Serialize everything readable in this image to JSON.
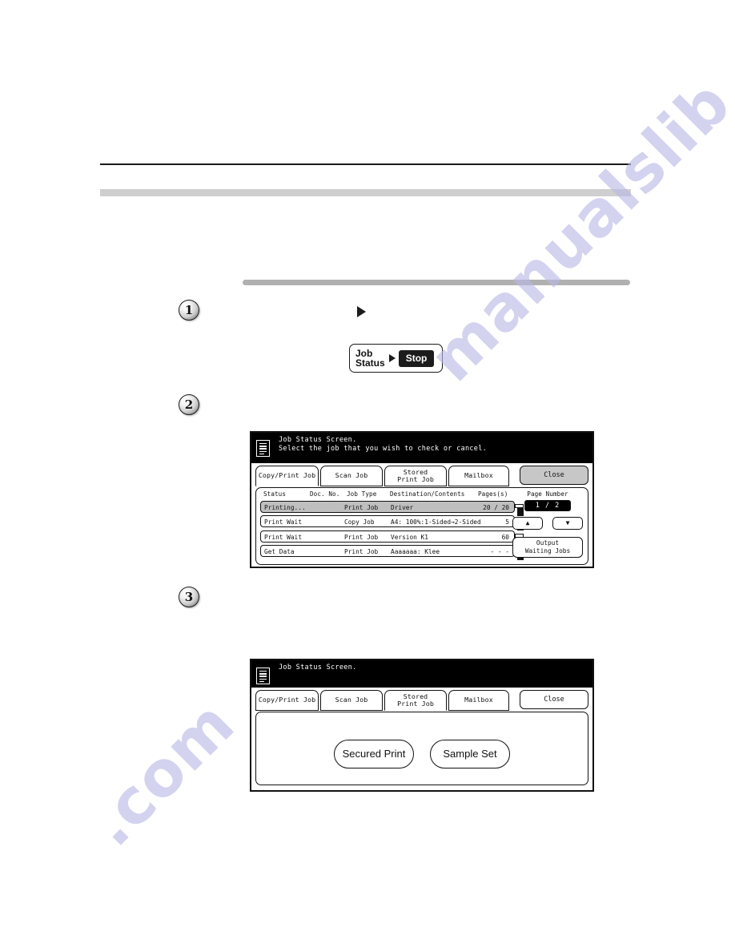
{
  "watermark": {
    "line_a": "manualslib",
    "line_b": ".com"
  },
  "step_markers": {
    "one": "1",
    "two": "2",
    "three": "3"
  },
  "control_panel_key": {
    "label": "Job\nStatus",
    "arrow_icon": "right-triangle-icon",
    "stop_label": "Stop"
  },
  "upper_screen": {
    "title_line_1": "Job Status Screen.",
    "title_line_2": "Select the job that you wish to check or cancel.",
    "icon": "document-list-icon",
    "tabs": [
      {
        "label": "Copy/Print Job",
        "active": true
      },
      {
        "label": "Scan Job",
        "active": false
      },
      {
        "label": "Stored\nPrint Job",
        "active": false
      },
      {
        "label": "Mailbox",
        "active": false
      }
    ],
    "close_label": "Close",
    "columns": {
      "status": "Status",
      "doc_no": "Doc. No.",
      "job_type": "Job Type",
      "destination": "Destination/Contents",
      "pages": "Pages(s)"
    },
    "rows": [
      {
        "status": "Printing...",
        "job_type": "Print Job",
        "destination": "Driver",
        "pages": "20 / 20",
        "selected": true
      },
      {
        "status": "Print Wait",
        "job_type": "Copy Job",
        "destination": "A4: 100%:1-Sided→2-Sided",
        "pages": "5",
        "selected": false
      },
      {
        "status": "Print Wait",
        "job_type": "Print Job",
        "destination": "Version K1",
        "pages": "60",
        "selected": false
      },
      {
        "status": "Get Data",
        "job_type": "Print Job",
        "destination": "Aaaaaaa: Klee",
        "pages": "- - -",
        "selected": false
      }
    ],
    "page_number_label": "Page Number",
    "page_number_value": "1 / 2",
    "up_arrow": "▲",
    "down_arrow": "▼",
    "output_waiting_label": "Output\nWaiting Jobs"
  },
  "lower_screen": {
    "title_line_1": "Job Status Screen.",
    "icon": "document-list-icon",
    "tabs": [
      {
        "label": "Copy/Print Job",
        "active": false
      },
      {
        "label": "Scan Job",
        "active": false
      },
      {
        "label": "Stored\nPrint Job",
        "active": true
      },
      {
        "label": "Mailbox",
        "active": false
      }
    ],
    "close_label": "Close",
    "buttons": [
      {
        "label": "Secured Print"
      },
      {
        "label": "Sample Set"
      }
    ]
  }
}
